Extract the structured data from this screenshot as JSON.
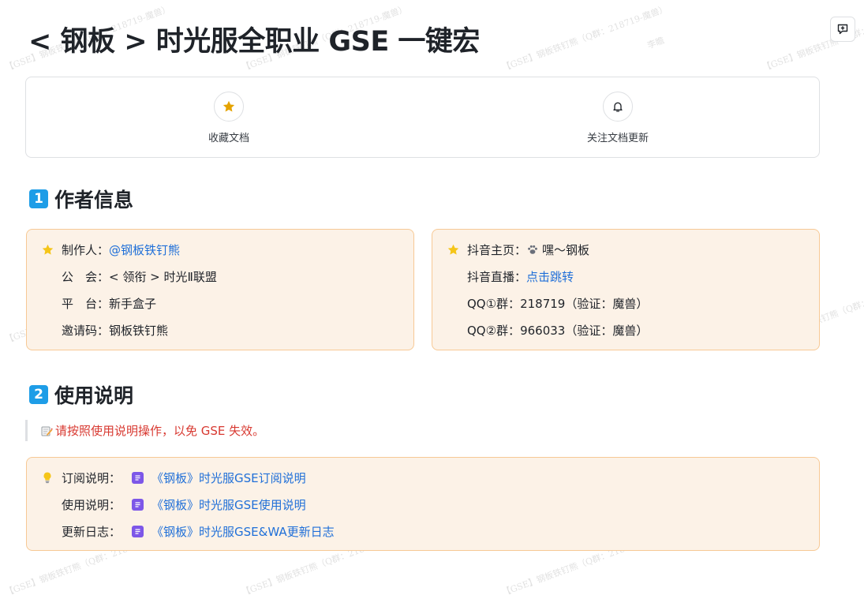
{
  "page": {
    "title": "< 钢板 > 时光服全职业 GSE 一键宏"
  },
  "actions": [
    {
      "label": "收藏文档",
      "icon": "star-icon"
    },
    {
      "label": "关注文档更新",
      "icon": "bell-icon"
    }
  ],
  "sections": {
    "author": {
      "num": "1",
      "title": "作者信息"
    },
    "usage": {
      "num": "2",
      "title": "使用说明"
    }
  },
  "author_card": {
    "producer_label": "制作人：",
    "producer_value": "@钢板铁钉熊",
    "guild_label": "公　会：",
    "guild_value": "< 领衔 > 时光Ⅱ联盟",
    "platform_label": "平　台：",
    "platform_value": "新手盒子",
    "invite_label": "邀请码：",
    "invite_value": "钢板铁钉熊"
  },
  "social_card": {
    "douyin_label": "抖音主页：",
    "douyin_value": "嘿～钢板",
    "live_label": "抖音直播：",
    "live_value": "点击跳转",
    "qq1_label": "QQ①群：",
    "qq1_value": "218719（验证：魔兽）",
    "qq2_label": "QQ②群：",
    "qq2_value": "966033（验证：魔兽）"
  },
  "notice": "请按照使用说明操作，以免 GSE 失效。",
  "usage_card": [
    {
      "label": "订阅说明：",
      "link": "《钢板》时光服GSE订阅说明"
    },
    {
      "label": "使用说明：",
      "link": "《钢板》时光服GSE使用说明"
    },
    {
      "label": "更新日志：",
      "link": "《钢板》时光服GSE&WA更新日志"
    }
  ],
  "watermark": {
    "line1": "【GSE】钢板铁钉熊（Q群：218719-魔兽）",
    "line2": "李瞻"
  },
  "colors": {
    "accent_blue": "#1e9de7",
    "link": "#1f6fd8",
    "callout_bg": "#fcf2e7",
    "callout_border": "#f7c995",
    "notice_red": "#d83931",
    "star": "#e5a300",
    "doc_icon": "#7d57e8"
  }
}
